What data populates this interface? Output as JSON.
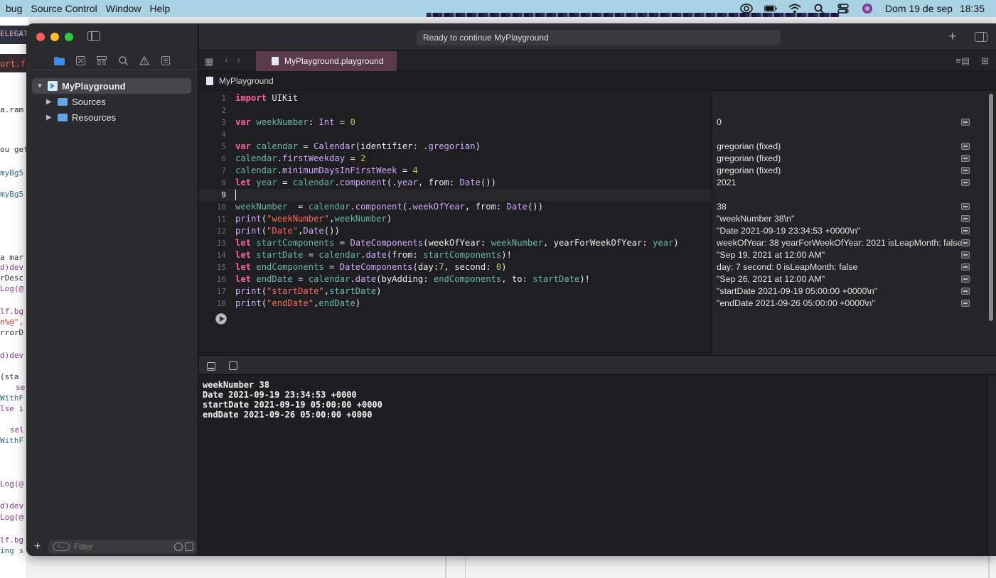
{
  "menubar": {
    "items": [
      "bug",
      "Source Control",
      "Window",
      "Help"
    ],
    "date": "Dom 19 de sep",
    "time": "18:35"
  },
  "background_fragments": [
    "ELEGAT",
    "ort.fre",
    "a.ram",
    "ou get",
    "myBg5",
    "myBg5",
    "a mar",
    "d)dev",
    "rDesc",
    "Log(@",
    "lf.bg",
    "n%@\",",
    "rrorD",
    "d)dev",
    "(sta",
    "se",
    "WithF",
    "lse i",
    "sel",
    "WithF",
    "Log(@",
    "d)dev",
    "Log(@",
    "lf.bg",
    "ing s"
  ],
  "toolbar": {
    "status": "Ready to continue MyPlayground"
  },
  "tab": {
    "label": "MyPlayground.playground"
  },
  "jumpbar": {
    "label": "MyPlayground"
  },
  "navigator": {
    "items": [
      {
        "label": "MyPlayground",
        "icon": "playground-icon",
        "expanded": true
      },
      {
        "label": "Sources",
        "icon": "folder-icon",
        "expanded": false
      },
      {
        "label": "Resources",
        "icon": "folder-icon",
        "expanded": false
      }
    ],
    "filter_placeholder": "Filter"
  },
  "editor": {
    "line_numbers": [
      "1",
      "2",
      "3",
      "4",
      "5",
      "6",
      "7",
      "8",
      "9",
      "10",
      "11",
      "12",
      "13",
      "14",
      "15",
      "16",
      "17",
      "18"
    ],
    "current_line": "9"
  },
  "results": [
    {
      "line": "3",
      "text": "0"
    },
    {
      "line": "5",
      "text": "gregorian (fixed)"
    },
    {
      "line": "6",
      "text": "gregorian (fixed)"
    },
    {
      "line": "7",
      "text": "gregorian (fixed)"
    },
    {
      "line": "8",
      "text": "2021"
    },
    {
      "line": "10",
      "text": "38"
    },
    {
      "line": "11",
      "text": "\"weekNumber 38\\n\""
    },
    {
      "line": "12",
      "text": "\"Date 2021-09-19 23:34:53 +0000\\n\""
    },
    {
      "line": "13",
      "text": "weekOfYear: 38 yearForWeekOfYear: 2021 isLeapMonth: false"
    },
    {
      "line": "14",
      "text": "\"Sep 19, 2021 at 12:00 AM\""
    },
    {
      "line": "15",
      "text": "day: 7 second: 0 isLeapMonth: false"
    },
    {
      "line": "16",
      "text": "\"Sep 26, 2021 at 12:00 AM\""
    },
    {
      "line": "17",
      "text": "\"startDate 2021-09-19 05:00:00 +0000\\n\""
    },
    {
      "line": "18",
      "text": "\"endDate 2021-09-26 05:00:00 +0000\\n\""
    }
  ],
  "console": [
    "weekNumber 38",
    "Date 2021-09-19 23:34:53 +0000",
    "startDate 2021-09-19 05:00:00 +0000",
    "endDate 2021-09-26 05:00:00 +0000"
  ],
  "colors": {
    "menubar": "#a9d3e4",
    "active_tab": "#5a3a4a",
    "keyword": "#fc5fa3",
    "string": "#fc6a5d",
    "number": "#d0bf69",
    "type": "#d0a8ff",
    "function": "#67b7a4",
    "accent": "#3b8ef0"
  }
}
